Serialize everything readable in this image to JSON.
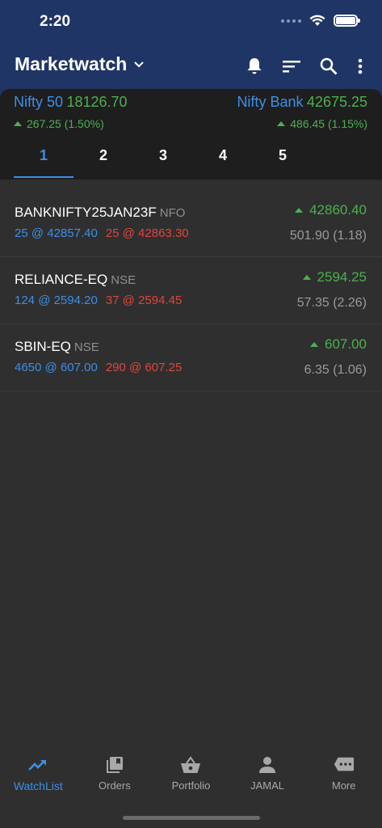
{
  "status_bar": {
    "time": "2:20"
  },
  "header": {
    "title": "Marketwatch"
  },
  "indices": {
    "left": {
      "name": "Nifty 50",
      "value": "18126.70",
      "change": "267.25 (1.50%)"
    },
    "right": {
      "name": "Nifty Bank",
      "value": "42675.25",
      "change": "486.45 (1.15%)"
    }
  },
  "tabs": [
    {
      "label": "1",
      "active": true
    },
    {
      "label": "2"
    },
    {
      "label": "3"
    },
    {
      "label": "4"
    },
    {
      "label": "5"
    }
  ],
  "watchlist": [
    {
      "symbol": "BANKNIFTY25JAN23F",
      "exchange": "NFO",
      "bid": "25 @ 42857.40",
      "ask": "25 @ 42863.30",
      "ltp": "42860.40",
      "change": "501.90 (1.18)"
    },
    {
      "symbol": "RELIANCE-EQ",
      "exchange": "NSE",
      "bid": "124 @ 2594.20",
      "ask": "37 @ 2594.45",
      "ltp": "2594.25",
      "change": "57.35 (2.26)"
    },
    {
      "symbol": "SBIN-EQ",
      "exchange": "NSE",
      "bid": "4650 @ 607.00",
      "ask": "290 @ 607.25",
      "ltp": "607.00",
      "change": "6.35 (1.06)"
    }
  ],
  "bottom_nav": [
    {
      "label": "WatchList",
      "icon": "trending-up-icon",
      "active": true
    },
    {
      "label": "Orders",
      "icon": "library-books-icon"
    },
    {
      "label": "Portfolio",
      "icon": "basket-icon"
    },
    {
      "label": "JAMAL",
      "icon": "person-icon"
    },
    {
      "label": "More",
      "icon": "more-chat-icon"
    }
  ],
  "colors": {
    "header_bg": "#1f3566",
    "accent": "#3d8ee8",
    "up": "#4cb050",
    "down": "#e0453c",
    "background": "#2f2f2f"
  }
}
